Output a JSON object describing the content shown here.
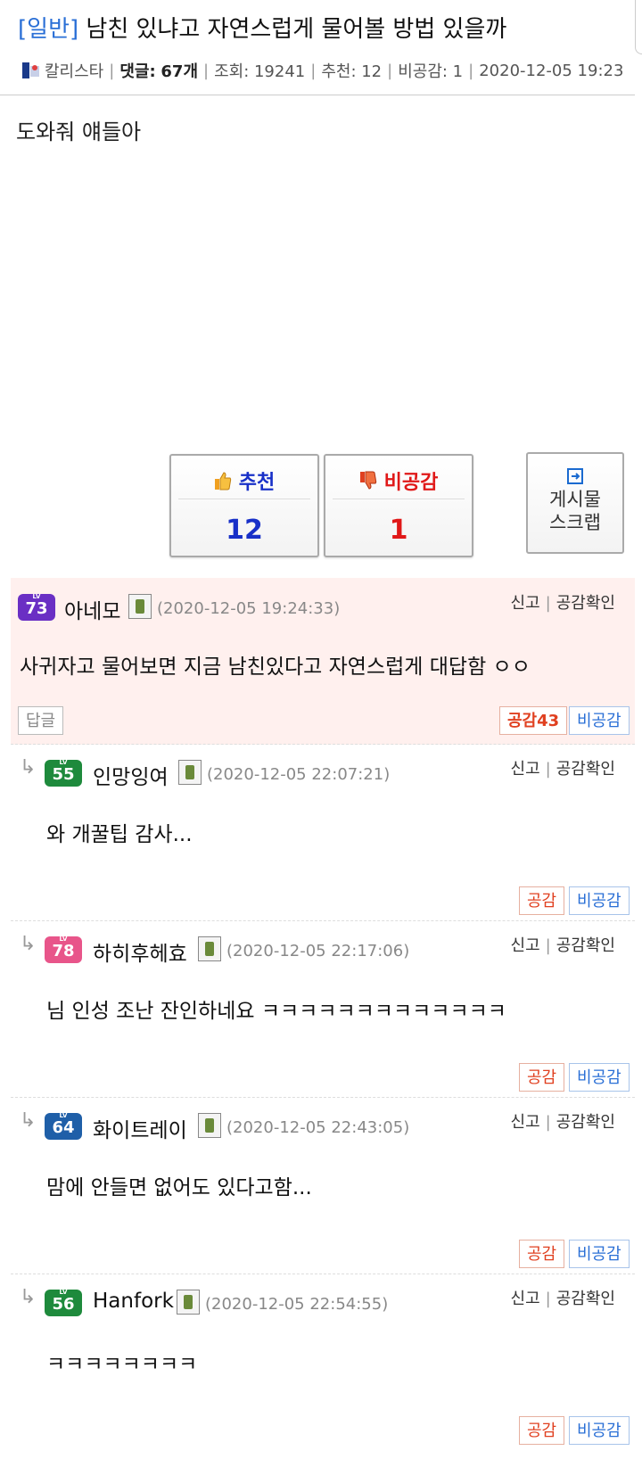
{
  "post": {
    "category": "[일반]",
    "title": "남친 있냐고 자연스럽게 물어볼 방법 있을까",
    "author": "칼리스타",
    "comments_label": "댓글:",
    "comments_count": "67개",
    "views": "조회: 19241",
    "recommend_meta": "추천: 12",
    "dislike_meta": "비공감: 1",
    "datetime": "2020-12-05 19:23",
    "body": "도와줘 얘들아"
  },
  "vote": {
    "recommend_label": "추천",
    "recommend_count": "12",
    "dislike_label": "비공감",
    "dislike_count": "1",
    "scrap_line1": "게시물",
    "scrap_line2": "스크랩"
  },
  "comment_ctrl": {
    "report": "신고",
    "empathy_check": "공감확인",
    "like": "공감",
    "dislike": "비공감",
    "reply": "답글"
  },
  "comments": [
    {
      "level": "73",
      "level_color": "#6a2fc4",
      "nick": "아네모",
      "date": "(2020-12-05 19:24:33)",
      "text": "사귀자고 물어보면 지금 남친있다고 자연스럽게 대답함 ㅇㅇ",
      "like_label": "공감43"
    },
    {
      "level": "55",
      "level_color": "#1e8a3c",
      "nick": "인망잉여",
      "date": "(2020-12-05 22:07:21)",
      "text": "와 개꿀팁 감사..."
    },
    {
      "level": "78",
      "level_color": "#e8558a",
      "nick": "하히후헤효",
      "date": "(2020-12-05 22:17:06)",
      "text": "님 인성 조난 잔인하네요 ㅋㅋㅋㅋㅋㅋㅋㅋㅋㅋㅋㅋㅋ"
    },
    {
      "level": "64",
      "level_color": "#1f5fa8",
      "nick": "화이트레이",
      "date": "(2020-12-05 22:43:05)",
      "text": "맘에 안들면 없어도 있다고함..."
    },
    {
      "level": "56",
      "level_color": "#1e8a3c",
      "nick": "Hanfork",
      "date": "(2020-12-05 22:54:55)",
      "text": "ㅋㅋㅋㅋㅋㅋㅋㅋ"
    }
  ]
}
